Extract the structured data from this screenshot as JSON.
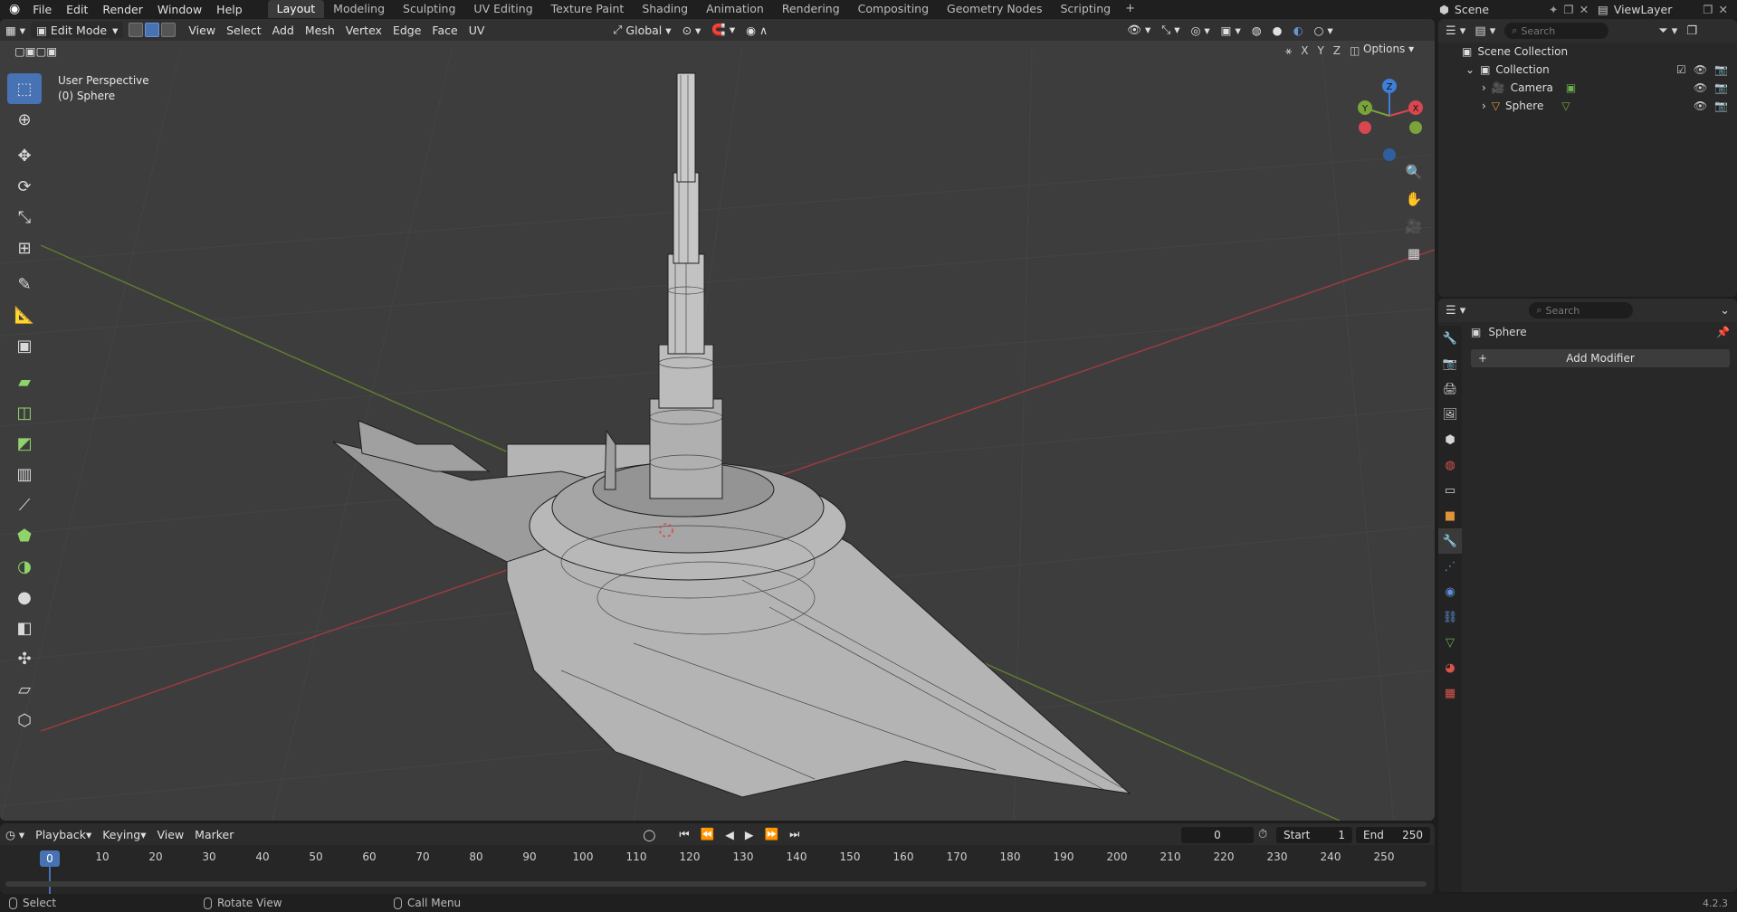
{
  "app_menu": [
    "File",
    "Edit",
    "Render",
    "Window",
    "Help"
  ],
  "workspaces": [
    "Layout",
    "Modeling",
    "Sculpting",
    "UV Editing",
    "Texture Paint",
    "Shading",
    "Animation",
    "Rendering",
    "Compositing",
    "Geometry Nodes",
    "Scripting"
  ],
  "active_workspace": "Layout",
  "scene_name": "Scene",
  "view_layer": "ViewLayer",
  "viewport": {
    "mode": "Edit Mode",
    "menus": [
      "View",
      "Select",
      "Add",
      "Mesh",
      "Vertex",
      "Edge",
      "Face",
      "UV"
    ],
    "transform_orientation": "Global",
    "options_label": "Options",
    "axes": [
      "X",
      "Y",
      "Z"
    ],
    "info_line1": "User Perspective",
    "info_line2": "(0) Sphere",
    "gizmo_axes": [
      "X",
      "Y",
      "Z"
    ]
  },
  "timeline": {
    "menus": [
      "Playback",
      "Keying",
      "View",
      "Marker"
    ],
    "current_frame": "0",
    "start_label": "Start",
    "start": "1",
    "end_label": "End",
    "end": "250",
    "ticks": [
      "0",
      "10",
      "20",
      "30",
      "40",
      "50",
      "60",
      "70",
      "80",
      "90",
      "100",
      "110",
      "120",
      "130",
      "140",
      "150",
      "160",
      "170",
      "180",
      "190",
      "200",
      "210",
      "220",
      "230",
      "240",
      "250"
    ]
  },
  "status": {
    "select": "Select",
    "rotate": "Rotate View",
    "menu": "Call Menu",
    "version": "4.2.3"
  },
  "outliner": {
    "search_placeholder": "Search",
    "scene_collection": "Scene Collection",
    "collection": "Collection",
    "items": [
      "Camera",
      "Sphere"
    ]
  },
  "properties": {
    "search_placeholder": "Search",
    "object_name": "Sphere",
    "add_modifier": "Add Modifier"
  },
  "colors": {
    "accent": "#4772b3",
    "x_axis": "#d8474f",
    "y_axis": "#7aa33a",
    "z_axis": "#3d7fd9"
  }
}
